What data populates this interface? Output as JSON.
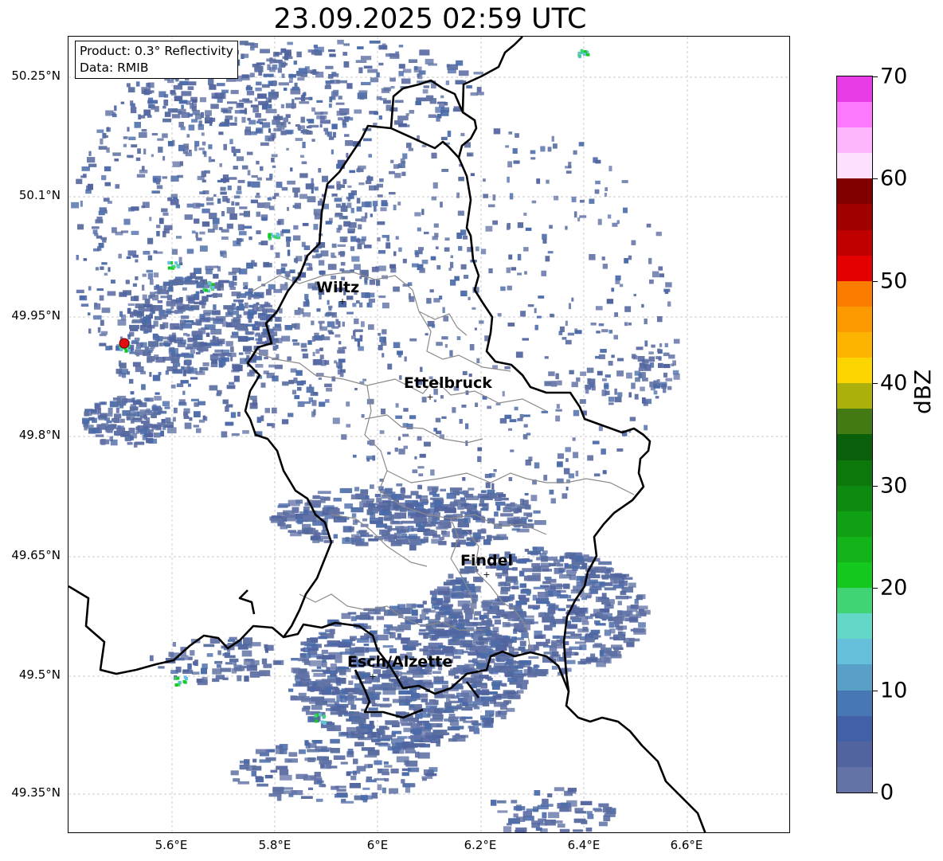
{
  "title": "23.09.2025 02:59 UTC",
  "info": {
    "product": "Product: 0.3° Reflectivity",
    "data": "Data: RMIB"
  },
  "lat_ticks": [
    "50.25°N",
    "50.1°N",
    "49.95°N",
    "49.8°N",
    "49.65°N",
    "49.5°N",
    "49.35°N"
  ],
  "lon_ticks": [
    "5.6°E",
    "5.8°E",
    "6°E",
    "6.2°E",
    "6.4°E",
    "6.6°E"
  ],
  "cities": [
    {
      "name": "Wiltz"
    },
    {
      "name": "Ettelbruck"
    },
    {
      "name": "Findel"
    },
    {
      "name": "Esch/Alzette"
    }
  ],
  "colorbar": {
    "label": "dBZ",
    "ticks": [
      "0",
      "10",
      "20",
      "30",
      "40",
      "50",
      "60",
      "70"
    ],
    "colors": [
      "#6373a6",
      "#52649f",
      "#4160a8",
      "#4878b4",
      "#58a0c8",
      "#66c0dc",
      "#64d8c8",
      "#40d474",
      "#14c81e",
      "#12b41a",
      "#10a014",
      "#0e8a10",
      "#0c780c",
      "#0a600a",
      "#447a14",
      "#acb00a",
      "#fcd400",
      "#fcb400",
      "#fc9800",
      "#fc7c00",
      "#e40000",
      "#c00000",
      "#a00000",
      "#800000",
      "#fde0fc",
      "#fcb4fc",
      "#fc78fc",
      "#e83ce8"
    ]
  },
  "radar_marker_color": "#e01010"
}
